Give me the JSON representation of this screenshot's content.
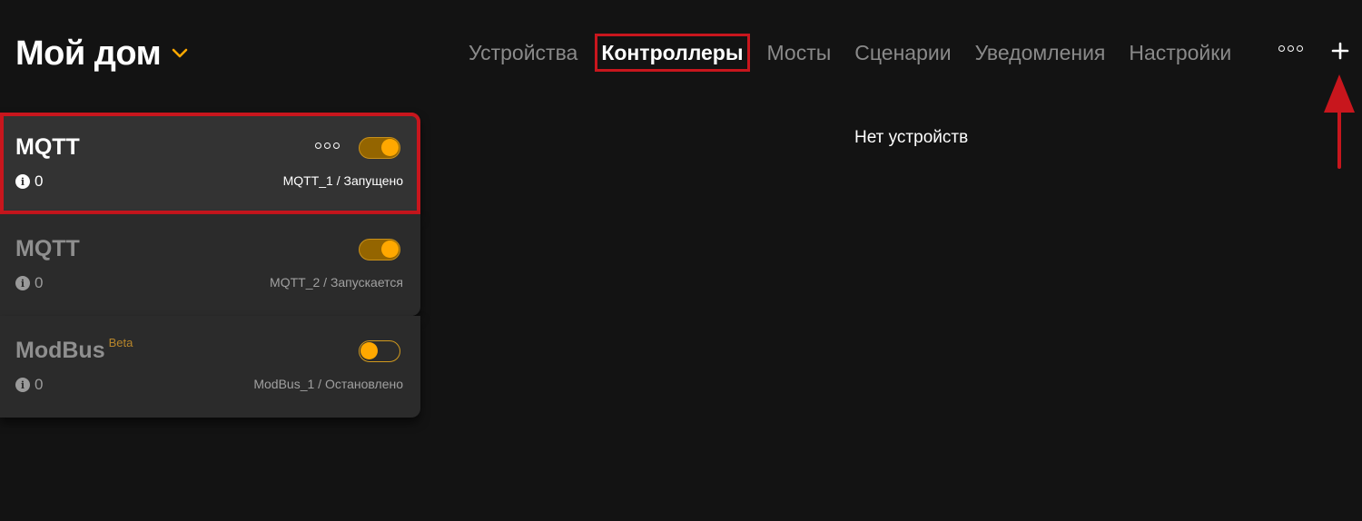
{
  "header": {
    "home_title": "Мой дом",
    "tabs": [
      {
        "label": "Устройства",
        "active": false
      },
      {
        "label": "Контроллеры",
        "active": true
      },
      {
        "label": "Мосты",
        "active": false
      },
      {
        "label": "Сценарии",
        "active": false
      },
      {
        "label": "Уведомления",
        "active": false
      },
      {
        "label": "Настройки",
        "active": false
      }
    ],
    "more_icon": "more-horizontal-icon",
    "add_icon": "plus-icon"
  },
  "controllers": [
    {
      "name": "MQTT",
      "badge": "",
      "info_count": "0",
      "status": "MQTT_1 / Запущено",
      "enabled": true,
      "has_menu": true
    },
    {
      "name": "MQTT",
      "badge": "",
      "info_count": "0",
      "status": "MQTT_2 / Запускается",
      "enabled": true,
      "has_menu": false
    },
    {
      "name": "ModBus",
      "badge": "Beta",
      "info_count": "0",
      "status": "ModBus_1 / Остановлено",
      "enabled": false,
      "has_menu": false
    }
  ],
  "main": {
    "empty_text": "Нет устройств"
  },
  "colors": {
    "background": "#131313",
    "accent": "#ffa800",
    "highlight": "#c8161d"
  }
}
